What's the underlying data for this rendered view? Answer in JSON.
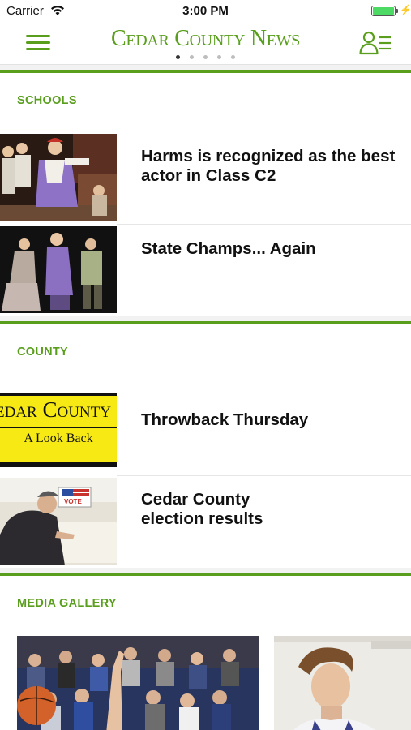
{
  "status_bar": {
    "carrier": "Carrier",
    "time": "3:00 PM",
    "battery_level": 1.0
  },
  "header": {
    "title": "Cedar County News",
    "page_count": 5,
    "active_page": 1
  },
  "sections": [
    {
      "title": "SCHOOLS",
      "articles": [
        {
          "headline": "Harms is recognized as the best actor in Class C2"
        },
        {
          "headline": "State Champs... Again"
        }
      ]
    },
    {
      "title": "COUNTY",
      "articles": [
        {
          "headline": "Throwback Thursday",
          "thumb_text_top": "Cedar County News",
          "thumb_text_bottom": "A Look Back"
        },
        {
          "headline": "Cedar County election results",
          "thumb_sign": "VOTE"
        }
      ]
    },
    {
      "title": "MEDIA GALLERY"
    }
  ],
  "colors": {
    "accent": "#5a9e1d",
    "background": "#f2f2f2",
    "battery": "#4cd964"
  }
}
